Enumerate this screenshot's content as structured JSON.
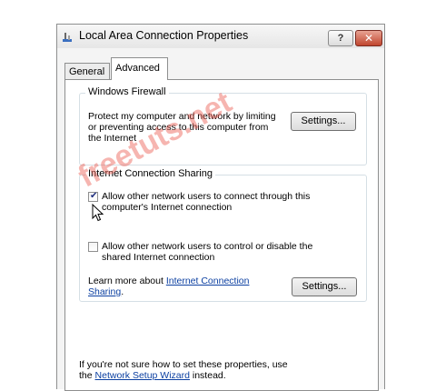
{
  "window": {
    "title": "Local Area Connection Properties",
    "help_label": "?",
    "close_label": "✕"
  },
  "tabs": [
    {
      "label": "General",
      "active": false
    },
    {
      "label": "Advanced",
      "active": true
    }
  ],
  "firewall": {
    "group_title": "Windows Firewall",
    "description": "Protect my computer and network by limiting or preventing access to this computer from the Internet",
    "settings_label": "Settings..."
  },
  "sharing": {
    "group_title": "Internet Connection Sharing",
    "allow_connect": {
      "label": "Allow other network users to connect through this computer's Internet connection",
      "checked": true
    },
    "allow_control": {
      "label": "Allow other network users to control or disable the shared Internet connection",
      "checked": false
    },
    "learn_prefix": "Learn more about ",
    "learn_link": "Internet Connection Sharing",
    "learn_suffix": ".",
    "settings_label": "Settings..."
  },
  "footer": {
    "line1": "If you're not sure how to set these properties, use",
    "prefix": "the ",
    "link": "Network Setup Wizard",
    "suffix": " instead."
  },
  "watermark": "freetuts.net",
  "colors": {
    "link": "#0b3fa1",
    "close": "#c0452e",
    "watermark": "#eb5a50"
  }
}
